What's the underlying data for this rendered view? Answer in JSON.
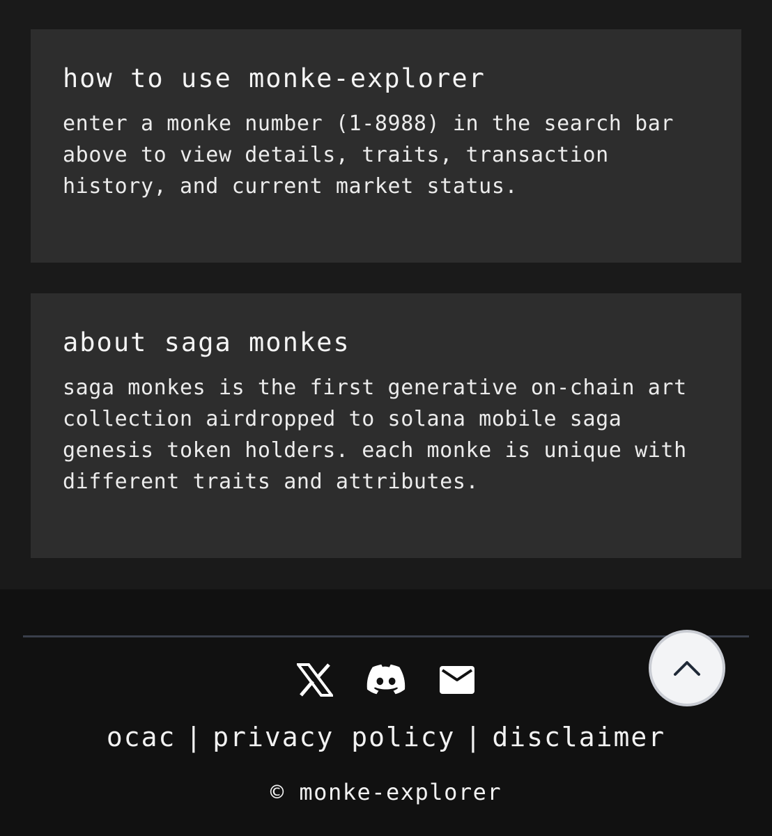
{
  "cards": [
    {
      "title": "how to use monke-explorer",
      "body": "enter a monke number (1-8988) in the search bar above to view details, traits, transaction history, and current market status."
    },
    {
      "title": "about saga monkes",
      "body": "saga monkes is the first generative on-chain art collection airdropped to solana mobile saga genesis token holders. each monke is unique with different traits and attributes."
    }
  ],
  "footer": {
    "socials": [
      {
        "icon": "x-icon"
      },
      {
        "icon": "discord-icon"
      },
      {
        "icon": "mail-icon"
      }
    ],
    "links": [
      "ocac",
      "privacy policy",
      "disclaimer"
    ],
    "separator": "|",
    "copyright": "© monke-explorer"
  },
  "scroll_top": {
    "icon": "chevron-up-icon"
  },
  "colors": {
    "page_bg": "#1a1a1a",
    "card_bg": "#2d2d2d",
    "footer_bg": "#111111",
    "divider": "#3a3f4b",
    "scroll_button_bg": "#f3f4f6"
  }
}
